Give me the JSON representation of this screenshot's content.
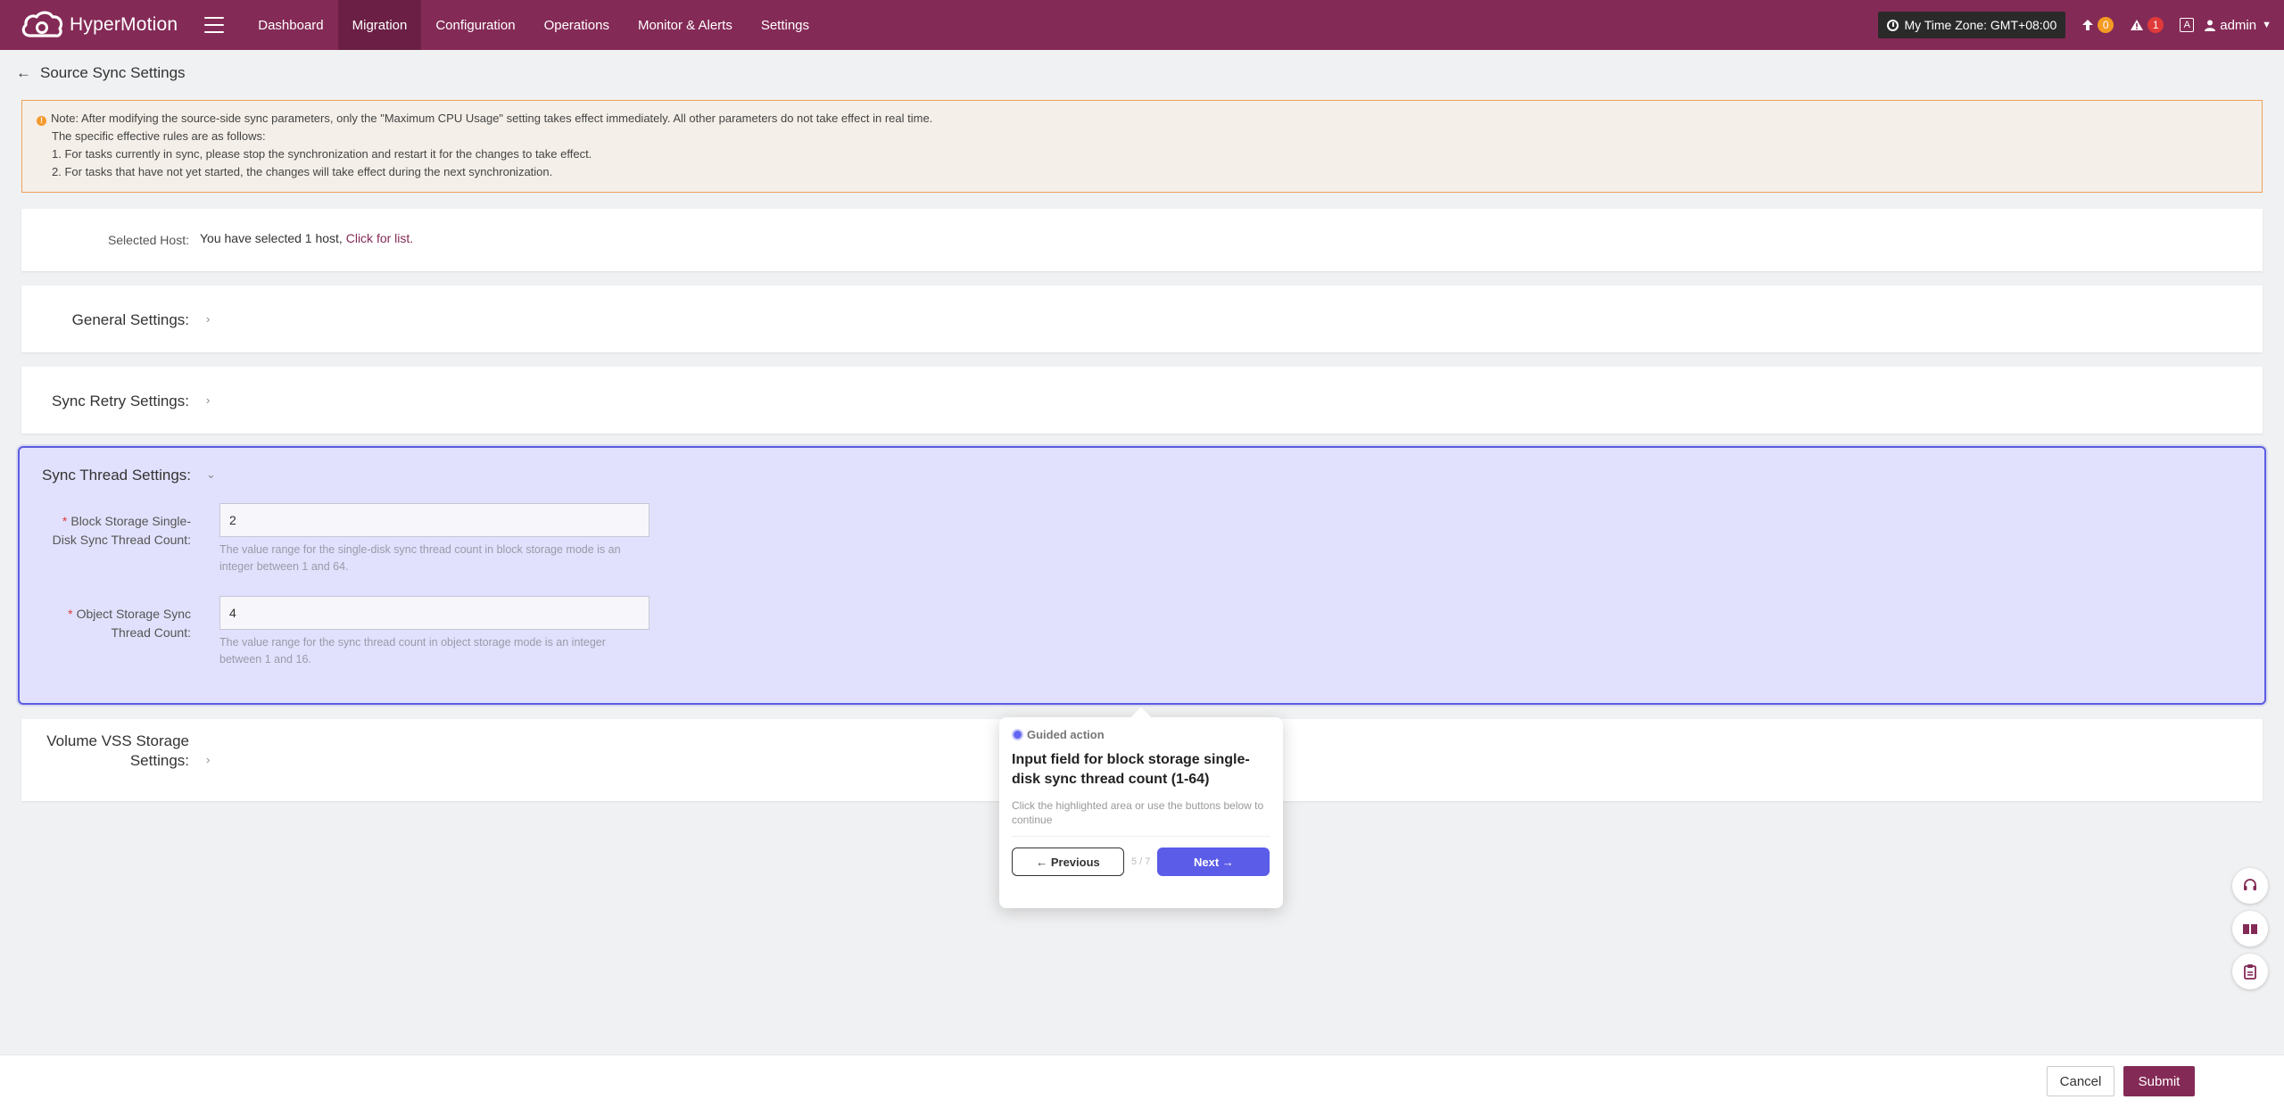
{
  "app": {
    "name": "HyperMotion",
    "brand_color": "#842a56"
  },
  "nav": {
    "items": [
      {
        "label": "Dashboard"
      },
      {
        "label": "Migration",
        "active": true
      },
      {
        "label": "Configuration"
      },
      {
        "label": "Operations"
      },
      {
        "label": "Monitor & Alerts"
      },
      {
        "label": "Settings"
      }
    ]
  },
  "topright": {
    "timezone": "My Time Zone: GMT+08:00",
    "upload_count": "0",
    "alert_count": "1",
    "lang_icon": "A",
    "user": "admin"
  },
  "page": {
    "title": "Source Sync Settings"
  },
  "notice": {
    "line1": "Note: After modifying the source-side sync parameters, only the \"Maximum CPU Usage\" setting takes effect immediately. All other parameters do not take effect in real time.",
    "line2": "The specific effective rules are as follows:",
    "line3": "1. For tasks currently in sync, please stop the synchronization and restart it for the changes to take effect.",
    "line4": "2. For tasks that have not yet started, the changes will take effect during the next synchronization."
  },
  "host": {
    "label": "Selected Host:",
    "text": "You have selected 1 host,",
    "link": "Click for list."
  },
  "sections": {
    "general": "General Settings:",
    "retry": "Sync Retry Settings:",
    "thread": "Sync Thread Settings:",
    "vss_line1": "Volume VSS Storage",
    "vss_line2": "Settings:"
  },
  "thread_fields": {
    "block_label_line1": "Block Storage Single-",
    "block_label_line2": "Disk Sync Thread Count:",
    "block_value": "2",
    "block_help": "The value range for the single-disk sync thread count in block storage mode is an integer between 1 and 64.",
    "object_label_line1": "Object Storage Sync",
    "object_label_line2": "Thread Count:",
    "object_value": "4",
    "object_help": "The value range for the sync thread count in object storage mode is an integer between 1 and 16."
  },
  "guide": {
    "tag": "Guided action",
    "title": "Input field for block storage single-disk sync thread count (1-64)",
    "desc": "Click the highlighted area or use the buttons below to continue",
    "prev": "← Previous",
    "step": "5 / 7",
    "next": "Next →",
    "accent": "#5b5ce8"
  },
  "footer": {
    "cancel": "Cancel",
    "submit": "Submit"
  }
}
